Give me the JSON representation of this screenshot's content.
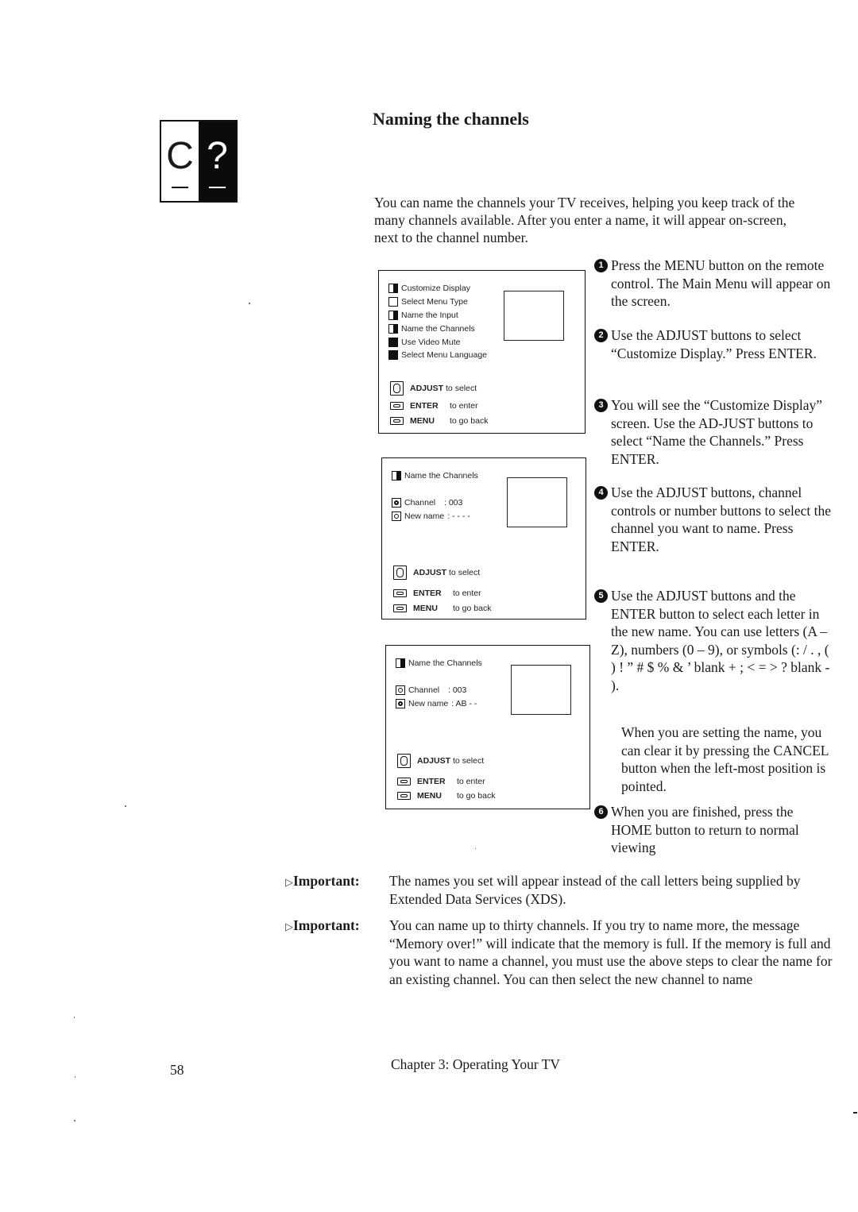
{
  "chapter_tab": {
    "left_glyph": "C",
    "right_glyph": "?"
  },
  "title": "Naming the channels",
  "intro": "You can name the channels your TV receives, helping you keep track of the many channels available. After you enter a name, it will appear on-screen, next to the channel number.",
  "screens": [
    {
      "menu_items": [
        {
          "icon": "customize-display-icon",
          "label": "Customize Display"
        },
        {
          "icon": "select-menu-type-icon",
          "label": "Select Menu Type"
        },
        {
          "icon": "name-input-icon",
          "label": "Name the Input"
        },
        {
          "icon": "name-channels-icon",
          "label": "Name the Channels"
        },
        {
          "icon": "video-mute-icon",
          "label": "Use Video Mute"
        },
        {
          "icon": "menu-language-icon",
          "label": "Select Menu Language"
        }
      ],
      "legend": [
        {
          "key": "ADJUST",
          "action": "to select"
        },
        {
          "key": "ENTER",
          "action": "to enter"
        },
        {
          "key": "MENU",
          "action": "to go back"
        }
      ]
    },
    {
      "heading": "Name the Channels",
      "fields": [
        {
          "label": "Channel",
          "value": ": 003",
          "selected": true
        },
        {
          "label": "New name",
          "value": ": - - - -",
          "selected": false
        }
      ],
      "legend": [
        {
          "key": "ADJUST",
          "action": "to select"
        },
        {
          "key": "ENTER",
          "action": "to enter"
        },
        {
          "key": "MENU",
          "action": "to go back"
        }
      ]
    },
    {
      "heading": "Name the Channels",
      "fields": [
        {
          "label": "Channel",
          "value": ": 003",
          "selected": false
        },
        {
          "label": "New name",
          "value": ": AB - -",
          "selected": true
        }
      ],
      "legend": [
        {
          "key": "ADJUST",
          "action": "to select"
        },
        {
          "key": "ENTER",
          "action": "to enter"
        },
        {
          "key": "MENU",
          "action": "to go back"
        }
      ]
    }
  ],
  "steps": [
    {
      "num": "1",
      "text": "Press the MENU button on the remote control. The Main Menu will appear on the screen."
    },
    {
      "num": "2",
      "text": "Use the ADJUST buttons to select “Customize Display.” Press ENTER."
    },
    {
      "num": "3",
      "text": "You will see the “Customize Display” screen. Use the AD-JUST buttons to select “Name the Channels.” Press ENTER."
    },
    {
      "num": "4",
      "text": "Use the ADJUST buttons, channel controls or number buttons to select the channel you want to name. Press ENTER."
    },
    {
      "num": "5",
      "text": "Use the ADJUST buttons and the ENTER button to select each letter in the new name. You can use letters (A – Z), numbers (0 – 9), or symbols (: / . , ( ) ! ” # $ % & ’ blank + ; < = > ? blank - )."
    },
    {
      "num": "6",
      "text": "When you are finished, press the HOME button to return to normal viewing"
    }
  ],
  "step5_note": "When you are setting the name, you can clear it by pressing the CANCEL button when the left-most position is pointed.",
  "important": [
    {
      "tag": "Important:",
      "text": "The names you set will appear instead of the call letters being supplied by Extended Data Services (XDS)."
    },
    {
      "tag": "Important:",
      "text": "You can name up to thirty channels. If you try to name more, the message “Memory over!” will indicate that the memory is full.  If the memory is full and you want to name a channel, you must use the above steps to clear the name for an existing channel.  You can then select the new channel to name"
    }
  ],
  "important_marker": "▷",
  "footer": {
    "page_number": "58",
    "chapter": "Chapter 3: Operating Your TV"
  }
}
